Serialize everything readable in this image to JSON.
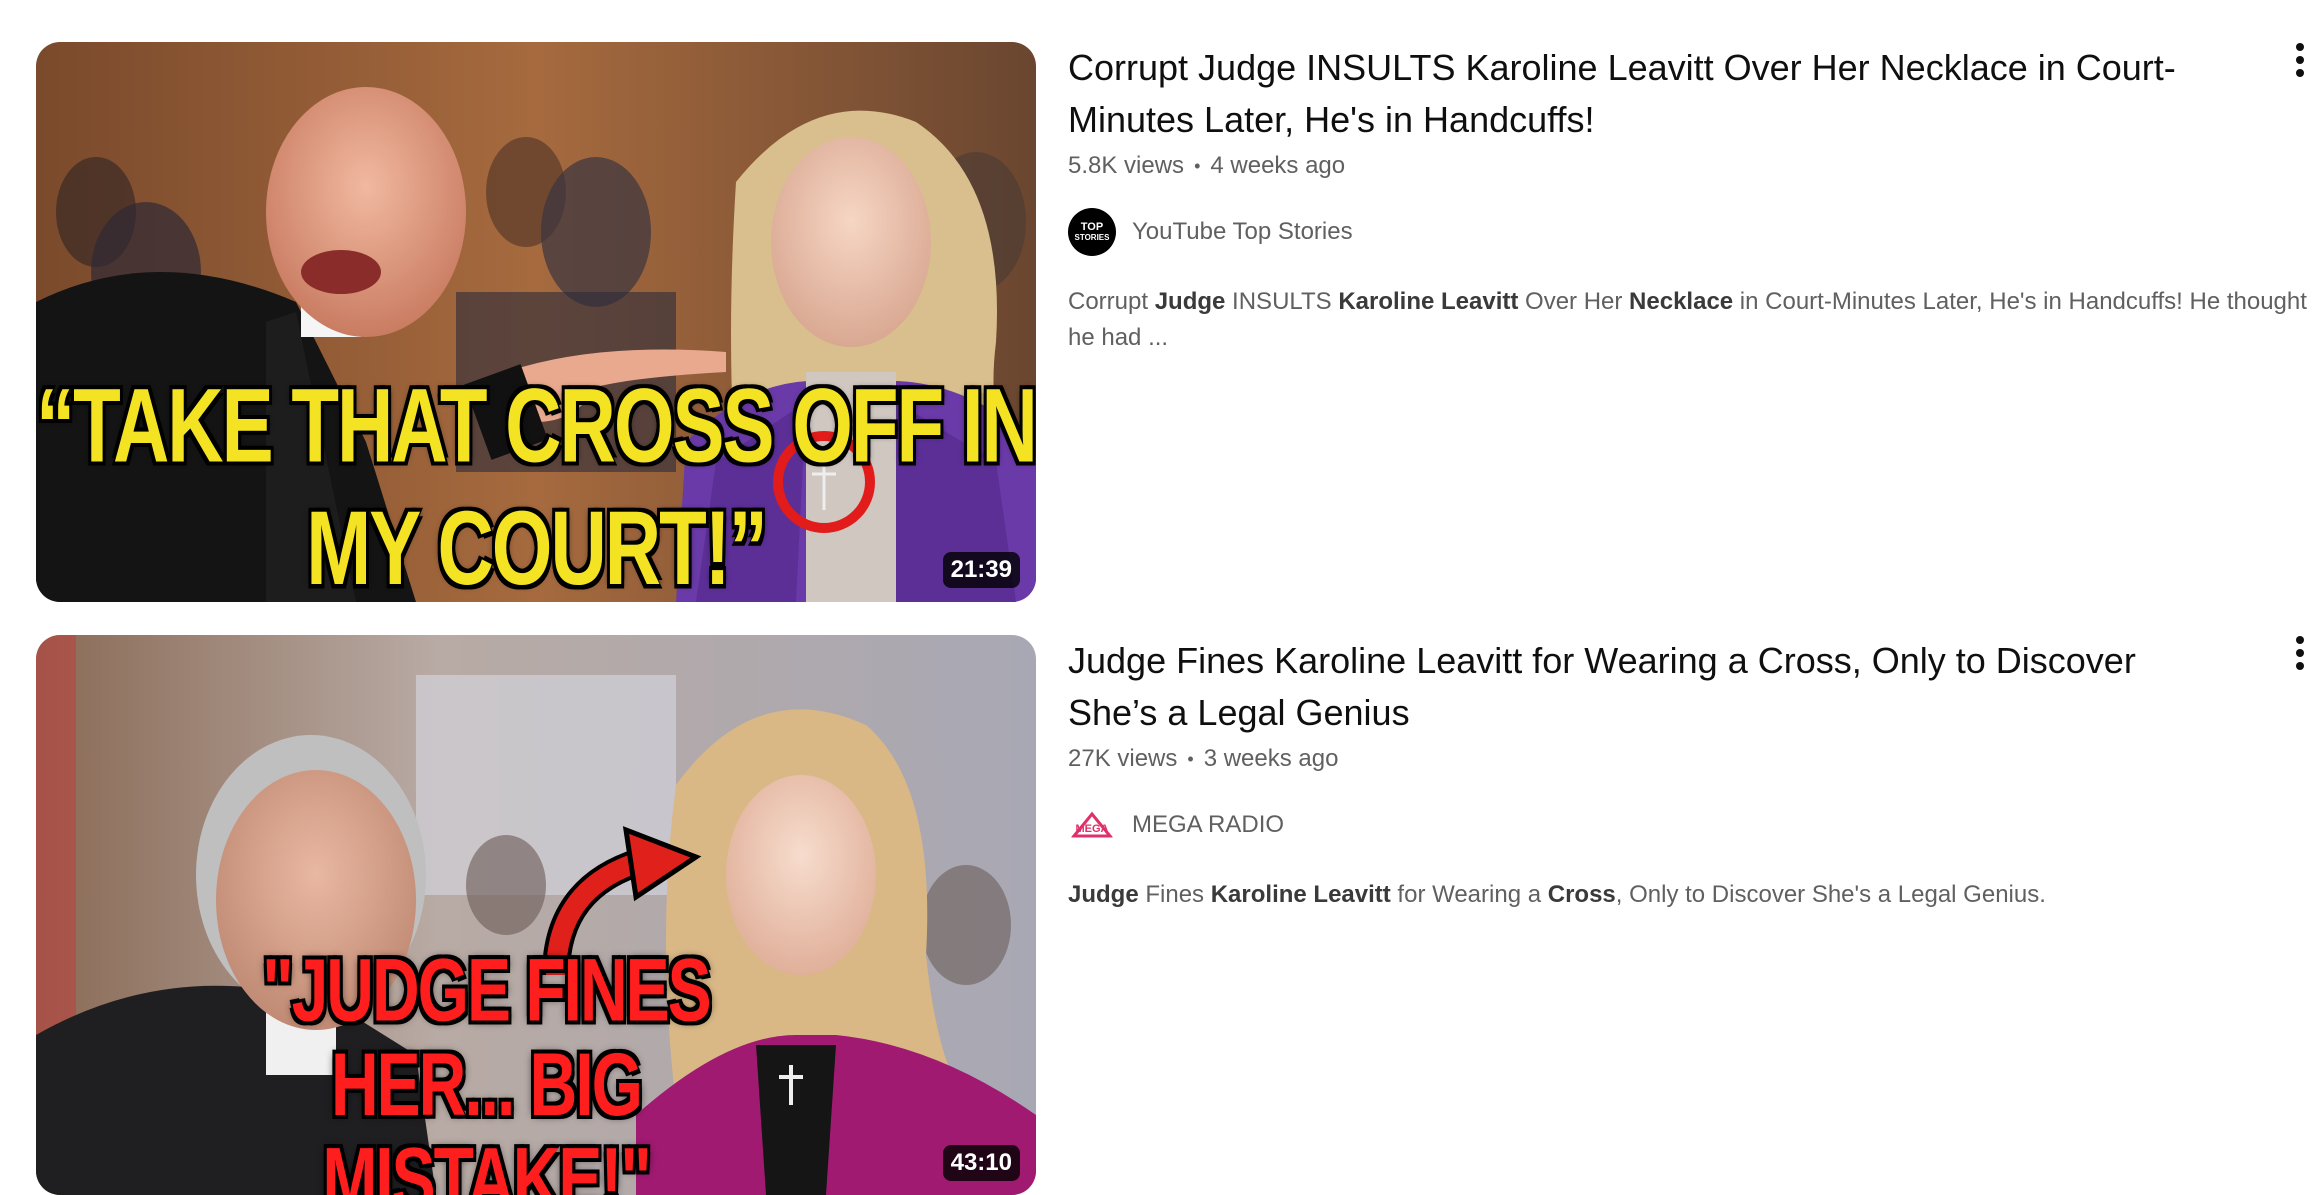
{
  "videos": [
    {
      "title": "Corrupt Judge INSULTS Karoline Leavitt Over Her Necklace in Court-Minutes Later, He's in Handcuffs!",
      "views": "5.8K views",
      "age": "4 weeks ago",
      "channel": "YouTube Top Stories",
      "channel_avatar_text": [
        "TOP",
        "STORIES"
      ],
      "duration": "21:39",
      "thumbnail_caption": "“TAKE THAT CROSS OFF IN MY COURT!”",
      "description": [
        {
          "text": "Corrupt ",
          "bold": false
        },
        {
          "text": "Judge",
          "bold": true
        },
        {
          "text": " INSULTS ",
          "bold": false
        },
        {
          "text": "Karoline Leavitt",
          "bold": true
        },
        {
          "text": " Over Her ",
          "bold": false
        },
        {
          "text": "Necklace",
          "bold": true
        },
        {
          "text": " in Court-Minutes Later, He's in Handcuffs! He thought he had ...",
          "bold": false
        }
      ]
    },
    {
      "title": "Judge Fines Karoline Leavitt for Wearing a Cross, Only to Discover She’s a Legal Genius",
      "views": "27K views",
      "age": "3 weeks ago",
      "channel": "MEGA RADIO",
      "channel_avatar_text": [
        "MEGA"
      ],
      "duration": "43:10",
      "thumbnail_caption": "\"JUDGE FINES HER... BIG MISTAKE!\"",
      "description": [
        {
          "text": "Judge",
          "bold": true
        },
        {
          "text": " Fines ",
          "bold": false
        },
        {
          "text": "Karoline Leavitt",
          "bold": true
        },
        {
          "text": " for Wearing a ",
          "bold": false
        },
        {
          "text": "Cross",
          "bold": true
        },
        {
          "text": ", Only to Discover She's a Legal Genius.",
          "bold": false
        }
      ]
    }
  ],
  "icons": {
    "menu": "more-vert-icon",
    "row1_circle_color": "#e21b1b",
    "row2_arrow_color": "#e0201b"
  }
}
